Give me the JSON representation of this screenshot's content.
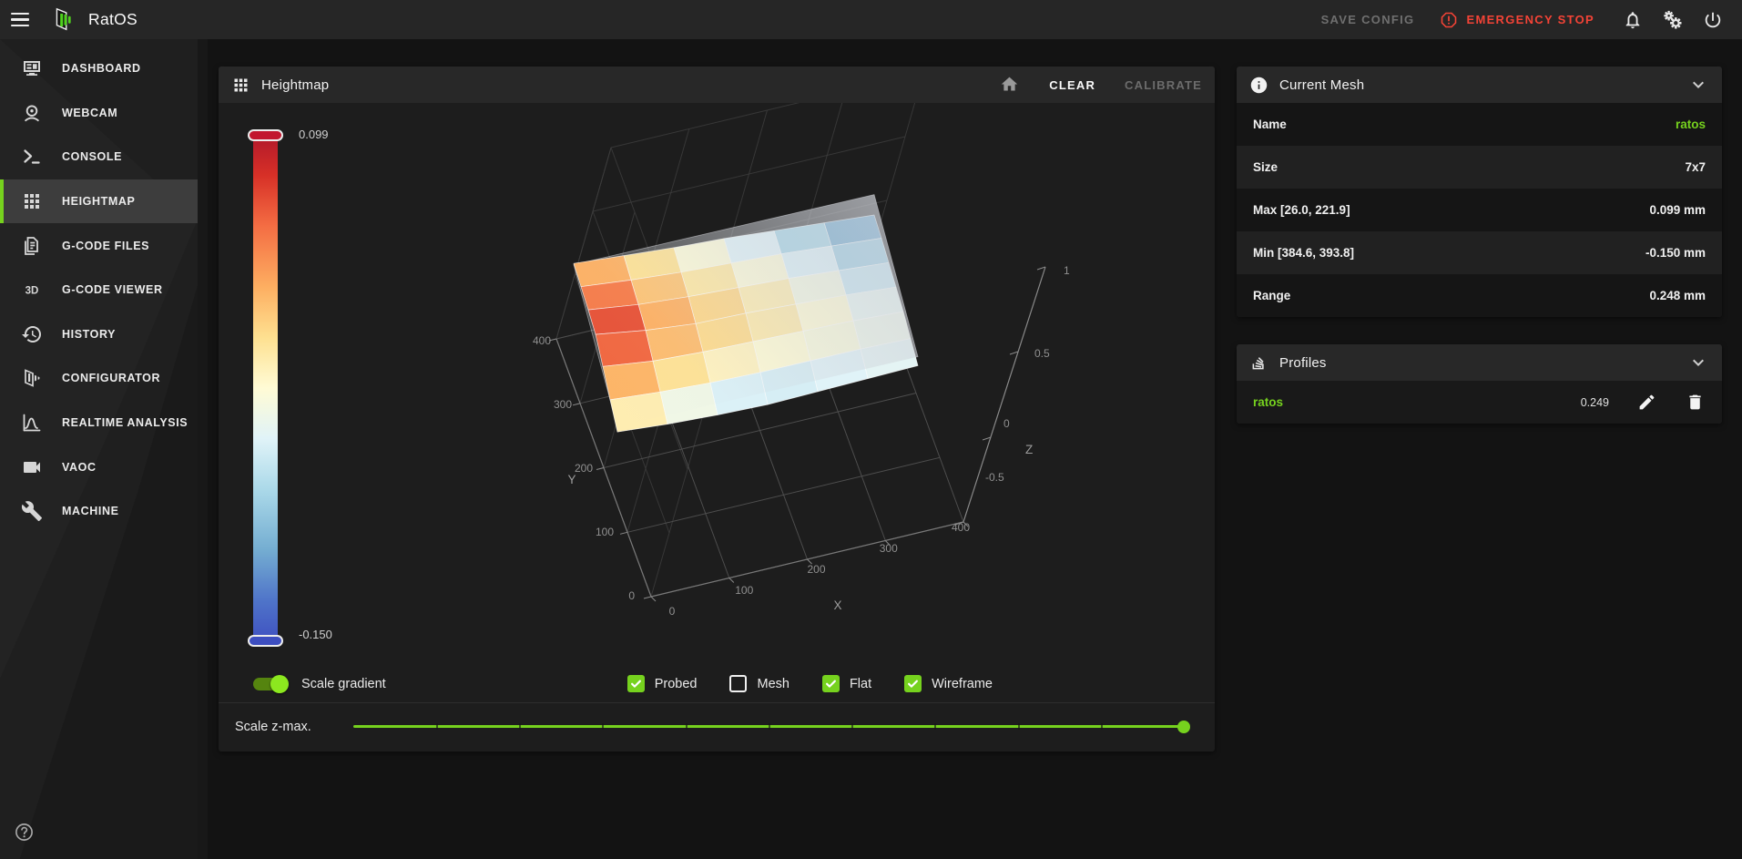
{
  "colors": {
    "accent": "#76d21e",
    "accent_bright": "#8ce81f",
    "danger": "#f44336",
    "colorbar_top": "#c2172f",
    "colorbar_bottom": "#3d4ec0"
  },
  "topbar": {
    "title": "RatOS",
    "save_config": "SAVE CONFIG",
    "emergency_stop": "EMERGENCY STOP",
    "icon_buttons": [
      "bell-icon",
      "cogs-icon",
      "power-icon"
    ]
  },
  "sidebar": {
    "items": [
      {
        "label": "DASHBOARD",
        "icon": "dashboard-icon",
        "active": false
      },
      {
        "label": "WEBCAM",
        "icon": "webcam-icon",
        "active": false
      },
      {
        "label": "CONSOLE",
        "icon": "console-icon",
        "active": false
      },
      {
        "label": "HEIGHTMAP",
        "icon": "heightmap-icon",
        "active": true
      },
      {
        "label": "G-CODE FILES",
        "icon": "gcode-files-icon",
        "active": false
      },
      {
        "label": "G-CODE VIEWER",
        "icon": "gcode-viewer-icon",
        "active": false
      },
      {
        "label": "HISTORY",
        "icon": "history-icon",
        "active": false
      },
      {
        "label": "CONFIGURATOR",
        "icon": "configurator-icon",
        "active": false
      },
      {
        "label": "REALTIME ANALYSIS",
        "icon": "realtime-analysis-icon",
        "active": false
      },
      {
        "label": "VAOC",
        "icon": "vaoc-icon",
        "active": false
      },
      {
        "label": "MACHINE",
        "icon": "machine-icon",
        "active": false
      }
    ]
  },
  "heightmap": {
    "title": "Heightmap",
    "actions": {
      "clear": "CLEAR",
      "calibrate": "CALIBRATE"
    },
    "toggle": {
      "label": "Scale gradient",
      "on": true
    },
    "checkboxes": [
      {
        "label": "Probed",
        "checked": true
      },
      {
        "label": "Mesh",
        "checked": false
      },
      {
        "label": "Flat",
        "checked": true
      },
      {
        "label": "Wireframe",
        "checked": true
      }
    ],
    "slider": {
      "label": "Scale z-max.",
      "value_pct": 100
    }
  },
  "current_mesh": {
    "title": "Current Mesh",
    "rows": [
      {
        "label": "Name",
        "value": "ratos",
        "accent": true
      },
      {
        "label": "Size",
        "value": "7x7",
        "accent": false
      },
      {
        "label": "Max [26.0, 221.9]",
        "value": "0.099 mm",
        "accent": false
      },
      {
        "label": "Min [384.6, 393.8]",
        "value": "-0.150 mm",
        "accent": false
      },
      {
        "label": "Range",
        "value": "0.248 mm",
        "accent": false
      }
    ]
  },
  "profiles": {
    "title": "Profiles",
    "rows": [
      {
        "name": "ratos",
        "value": "0.249"
      }
    ]
  },
  "chart_data": {
    "type": "surface",
    "x_label": "X",
    "y_label": "Y",
    "z_label": "Z",
    "x_ticks": [
      "0",
      "100",
      "200",
      "300",
      "400"
    ],
    "y_ticks": [
      "0",
      "100",
      "200",
      "300",
      "400"
    ],
    "z_ticks": [
      "-0.5",
      "0",
      "0.5",
      "1"
    ],
    "z_axis_range": [
      -0.5,
      1
    ],
    "colorbar": {
      "max_label": "0.099",
      "min_label": "-0.150"
    },
    "zmin": -0.15,
    "zmax": 0.099,
    "mesh_size": "7x7",
    "mesh_max": {
      "x": 26.0,
      "y": 221.9,
      "z": 0.099
    },
    "mesh_min": {
      "x": 384.6,
      "y": 393.8,
      "z": -0.15
    },
    "z_matrix": [
      [
        -0.03,
        -0.06,
        -0.08,
        -0.09,
        -0.08,
        -0.07,
        -0.06
      ],
      [
        0.01,
        -0.02,
        -0.04,
        -0.05,
        -0.05,
        -0.05,
        -0.06
      ],
      [
        0.06,
        0.01,
        -0.01,
        -0.02,
        -0.03,
        -0.04,
        -0.06
      ],
      [
        0.099,
        0.04,
        0.0,
        -0.01,
        -0.03,
        -0.05,
        -0.08
      ],
      [
        0.08,
        0.03,
        0.0,
        -0.02,
        -0.04,
        -0.07,
        -0.1
      ],
      [
        0.05,
        0.01,
        -0.02,
        -0.04,
        -0.06,
        -0.09,
        -0.12
      ],
      [
        0.02,
        -0.01,
        -0.04,
        -0.06,
        -0.09,
        -0.12,
        -0.15
      ]
    ],
    "colorscale": [
      [
        0,
        "#3f51c1"
      ],
      [
        0.12,
        "#74add1"
      ],
      [
        0.25,
        "#abd9e9"
      ],
      [
        0.35,
        "#e0f3f8"
      ],
      [
        0.45,
        "#fffbd5"
      ],
      [
        0.55,
        "#fee090"
      ],
      [
        0.68,
        "#fdae61"
      ],
      [
        0.8,
        "#f46d43"
      ],
      [
        0.92,
        "#d73027"
      ],
      [
        1,
        "#b1182b"
      ]
    ],
    "flat_plane_shown": true,
    "wireframe_shown": true,
    "probed_shown": true
  }
}
